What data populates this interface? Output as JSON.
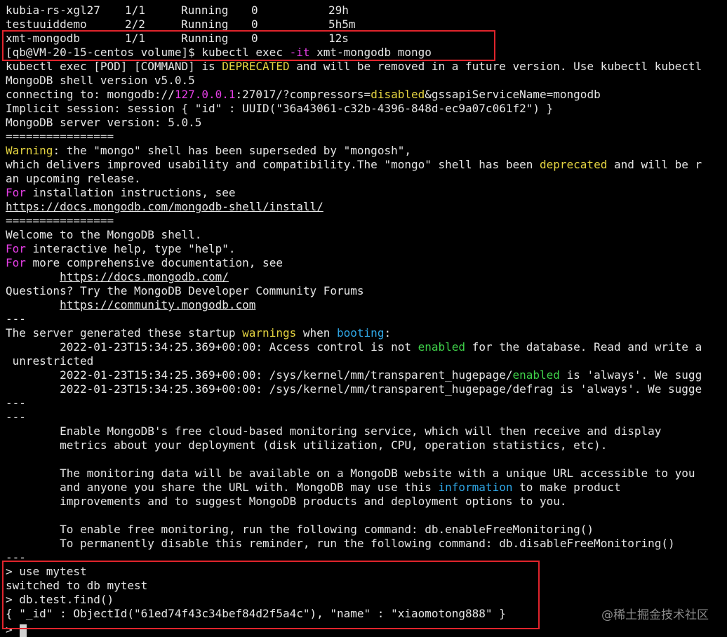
{
  "pod_rows": [
    {
      "name": "kubia-rs-xgl27",
      "ready": "1/1",
      "status": "Running",
      "restarts": "0",
      "age": "29h"
    },
    {
      "name": "testuuiddemo",
      "ready": "2/2",
      "status": "Running",
      "restarts": "0",
      "age": "5h5m"
    },
    {
      "name": "xmt-mongodb",
      "ready": "1/1",
      "status": "Running",
      "restarts": "0",
      "age": "12s"
    }
  ],
  "exec_prompt": "[qb@VM-20-15-centos volume]$ kubectl exec ",
  "exec_flag": "-it",
  "exec_target": " xmt-mongodb mongo",
  "deprecation": {
    "pre": "kubectl exec [POD] [COMMAND] is ",
    "word": "DEPRECATED",
    "post": " and will be removed in a future version. Use kubectl kubectl"
  },
  "shell_version": "MongoDB shell version v5.0.5",
  "connect": {
    "pre": "connecting to: mongodb://",
    "host": "127.0.0.1",
    "mid": ":27017/?compressors=",
    "comp": "disabled",
    "post": "&gssapiServiceName=mongodb"
  },
  "session": "Implicit session: session { \"id\" : UUID(\"36a43061-c32b-4396-848d-ec9a07c061f2\") }",
  "server_version": "MongoDB server version: 5.0.5",
  "sep": "================",
  "warning": {
    "label": "Warning",
    "text": ": the \"mongo\" shell has been superseded by \"mongosh\","
  },
  "delivers": {
    "pre": "which delivers improved usability and compatibility.The \"mongo\" shell has been ",
    "word": "deprecated",
    "post": " and will be r"
  },
  "upcoming": "an upcoming release.",
  "install": {
    "kw": "For",
    "text": " installation instructions, see"
  },
  "install_url": "https://docs.mongodb.com/mongodb-shell/install/",
  "welcome": "Welcome to the MongoDB shell.",
  "help": {
    "kw": "For",
    "text": " interactive help, type \"help\"."
  },
  "docs_line": {
    "kw": "For",
    "text": " more comprehensive documentation, see"
  },
  "docs_url": "https://docs.mongodb.com/",
  "questions": "Questions? Try the MongoDB Developer Community Forums",
  "community_url": "https://community.mongodb.com",
  "dashes": "---",
  "startup": {
    "pre": "The server generated these startup ",
    "w1": "warnings",
    "mid": " when ",
    "w2": "booting",
    "post": ":"
  },
  "ac_line": {
    "pre": "        2022-01-23T15:34:25.369+00:00: Access control is not ",
    "word": "enabled",
    "post": " for the database. Read and write a"
  },
  "unrestricted": " unrestricted",
  "hp1": {
    "pre": "        2022-01-23T15:34:25.369+00:00: /sys/kernel/mm/transparent_hugepage/",
    "word": "enabled",
    "post": " is 'always'. We sugg"
  },
  "hp2": "        2022-01-23T15:34:25.369+00:00: /sys/kernel/mm/transparent_hugepage/defrag is 'always'. We sugge",
  "mon1": "        Enable MongoDB's free cloud-based monitoring service, which will then receive and display",
  "mon2": "        metrics about your deployment (disk utilization, CPU, operation statistics, etc).",
  "mon3": "        The monitoring data will be available on a MongoDB website with a unique URL accessible to you",
  "mon4": {
    "pre": "        and anyone you share the URL with. MongoDB may use this ",
    "word": "information",
    "post": " to make product"
  },
  "mon5": "        improvements and to suggest MongoDB products and deployment options to you.",
  "mon6": "        To enable free monitoring, run the following command: db.enableFreeMonitoring()",
  "mon7": "        To permanently disable this reminder, run the following command: db.disableFreeMonitoring()",
  "cmd_use": "> use mytest",
  "switched": "switched to db mytest",
  "cmd_find": "> db.test.find()",
  "result": "{ \"_id\" : ObjectId(\"61ed74f43c34bef84d2f5a4c\"), \"name\" : \"xiaomotong888\" }",
  "prompt_char": ">",
  "watermark": "@稀土掘金技术社区",
  "colors": {
    "highlight_box": "#e0242c",
    "yellow": "#e5d441",
    "magenta": "#e63ee6",
    "green": "#3fd24a",
    "cyan": "#2fa7e6"
  }
}
